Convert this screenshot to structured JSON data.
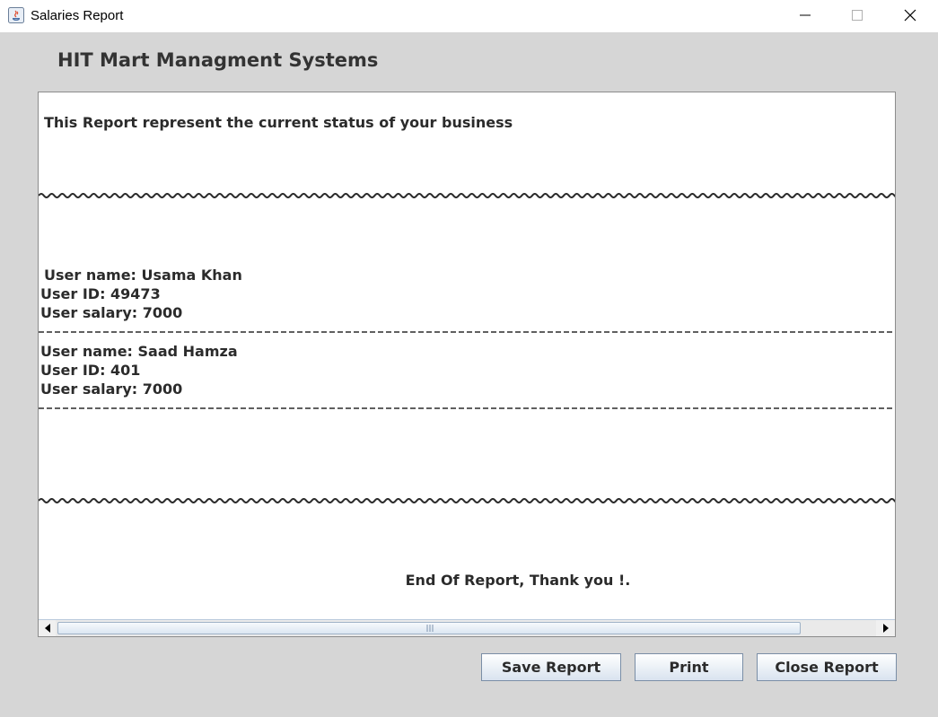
{
  "window": {
    "title": "Salaries Report"
  },
  "app": {
    "heading": "HIT Mart Managment Systems"
  },
  "report": {
    "intro": "This Report represent the current status of your business",
    "users": [
      {
        "name": "User name: Usama Khan",
        "id": "User ID: 49473",
        "salary": "User salary: 7000"
      },
      {
        "name": "User name: Saad Hamza",
        "id": "User ID: 401",
        "salary": "User salary: 7000"
      }
    ],
    "footer": "End Of Report, Thank you !."
  },
  "buttons": {
    "save_label": "Save Report",
    "print_label": "Print",
    "close_label": "Close Report"
  },
  "icons": {
    "app": "java-app-icon",
    "minimize": "minimize-icon",
    "maximize": "maximize-icon",
    "close": "close-icon",
    "scroll_left": "arrow-left-icon",
    "scroll_right": "arrow-right-icon"
  }
}
